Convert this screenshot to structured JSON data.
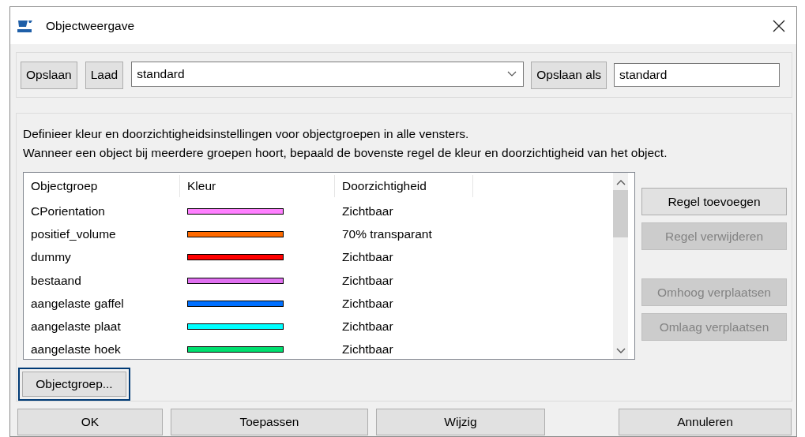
{
  "window": {
    "title": "Objectweergave"
  },
  "toolbar": {
    "save_button": "Opslaan",
    "load_button": "Laad",
    "preset": {
      "value": "standard"
    },
    "save_as_button": "Opslaan als",
    "save_as_name": {
      "value": "standard"
    }
  },
  "description": [
    "Definieer kleur en doorzichtigheidsinstellingen voor objectgroepen in alle vensters.",
    "Wanneer een object bij meerdere groepen hoort, bepaald de bovenste regel de kleur en doorzichtigheid van het object."
  ],
  "table": {
    "columns": [
      "Objectgroep",
      "Kleur",
      "Doorzichtigheid"
    ],
    "rows": [
      {
        "group": "CPorientation",
        "color": "#ff80ff",
        "transparency": "Zichtbaar"
      },
      {
        "group": "positief_volume",
        "color": "#ff6a00",
        "transparency": "70% transparant"
      },
      {
        "group": "dummy",
        "color": "#ff0000",
        "transparency": "Zichtbaar"
      },
      {
        "group": "bestaand",
        "color": "#e070f0",
        "transparency": "Zichtbaar"
      },
      {
        "group": "aangelaste gaffel",
        "color": "#0070ff",
        "transparency": "Zichtbaar"
      },
      {
        "group": "aangelaste plaat",
        "color": "#00ffff",
        "transparency": "Zichtbaar"
      },
      {
        "group": "aangelaste hoek",
        "color": "#00e070",
        "transparency": "Zichtbaar"
      }
    ]
  },
  "rule_buttons": [
    {
      "label": "Regel toevoegen",
      "disabled": false
    },
    {
      "label": "Regel verwijderen",
      "disabled": true
    },
    {
      "label": "Omhoog verplaatsen",
      "disabled": true
    },
    {
      "label": "Omlaag verplaatsen",
      "disabled": true
    }
  ],
  "group_button": {
    "label": "Objectgroep...",
    "focused": true
  },
  "dialog_buttons": [
    {
      "label": "OK"
    },
    {
      "label": "Toepassen"
    },
    {
      "label": "Wijzig"
    },
    {
      "label": "Annuleren"
    }
  ]
}
